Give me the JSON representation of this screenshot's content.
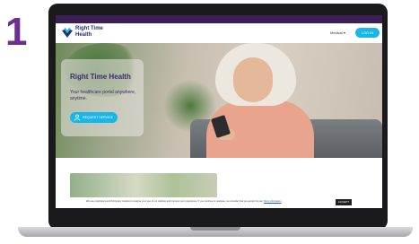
{
  "step_number": "1",
  "brand": {
    "name_line1": "Right Time",
    "name_line2": "Health"
  },
  "nav": {
    "menu_label": "Medical ▾",
    "login_label": "LOG IN"
  },
  "hero": {
    "title": "Right Time Health",
    "subtitle": "Your healthcare portal anywhere, anytime.",
    "button_label": "REQUEST SERVICE"
  },
  "cookie": {
    "text": "We use proprietary and third-party cookies to analyse your use of our website and improve your experience. If you continue to navigate, we consider that you accept its use.",
    "link": "More information",
    "accept_label": "ACCEPT"
  },
  "colors": {
    "accent": "#18b6ea",
    "brand_purple": "#3b1f55",
    "step_purple": "#6b2f8f"
  }
}
